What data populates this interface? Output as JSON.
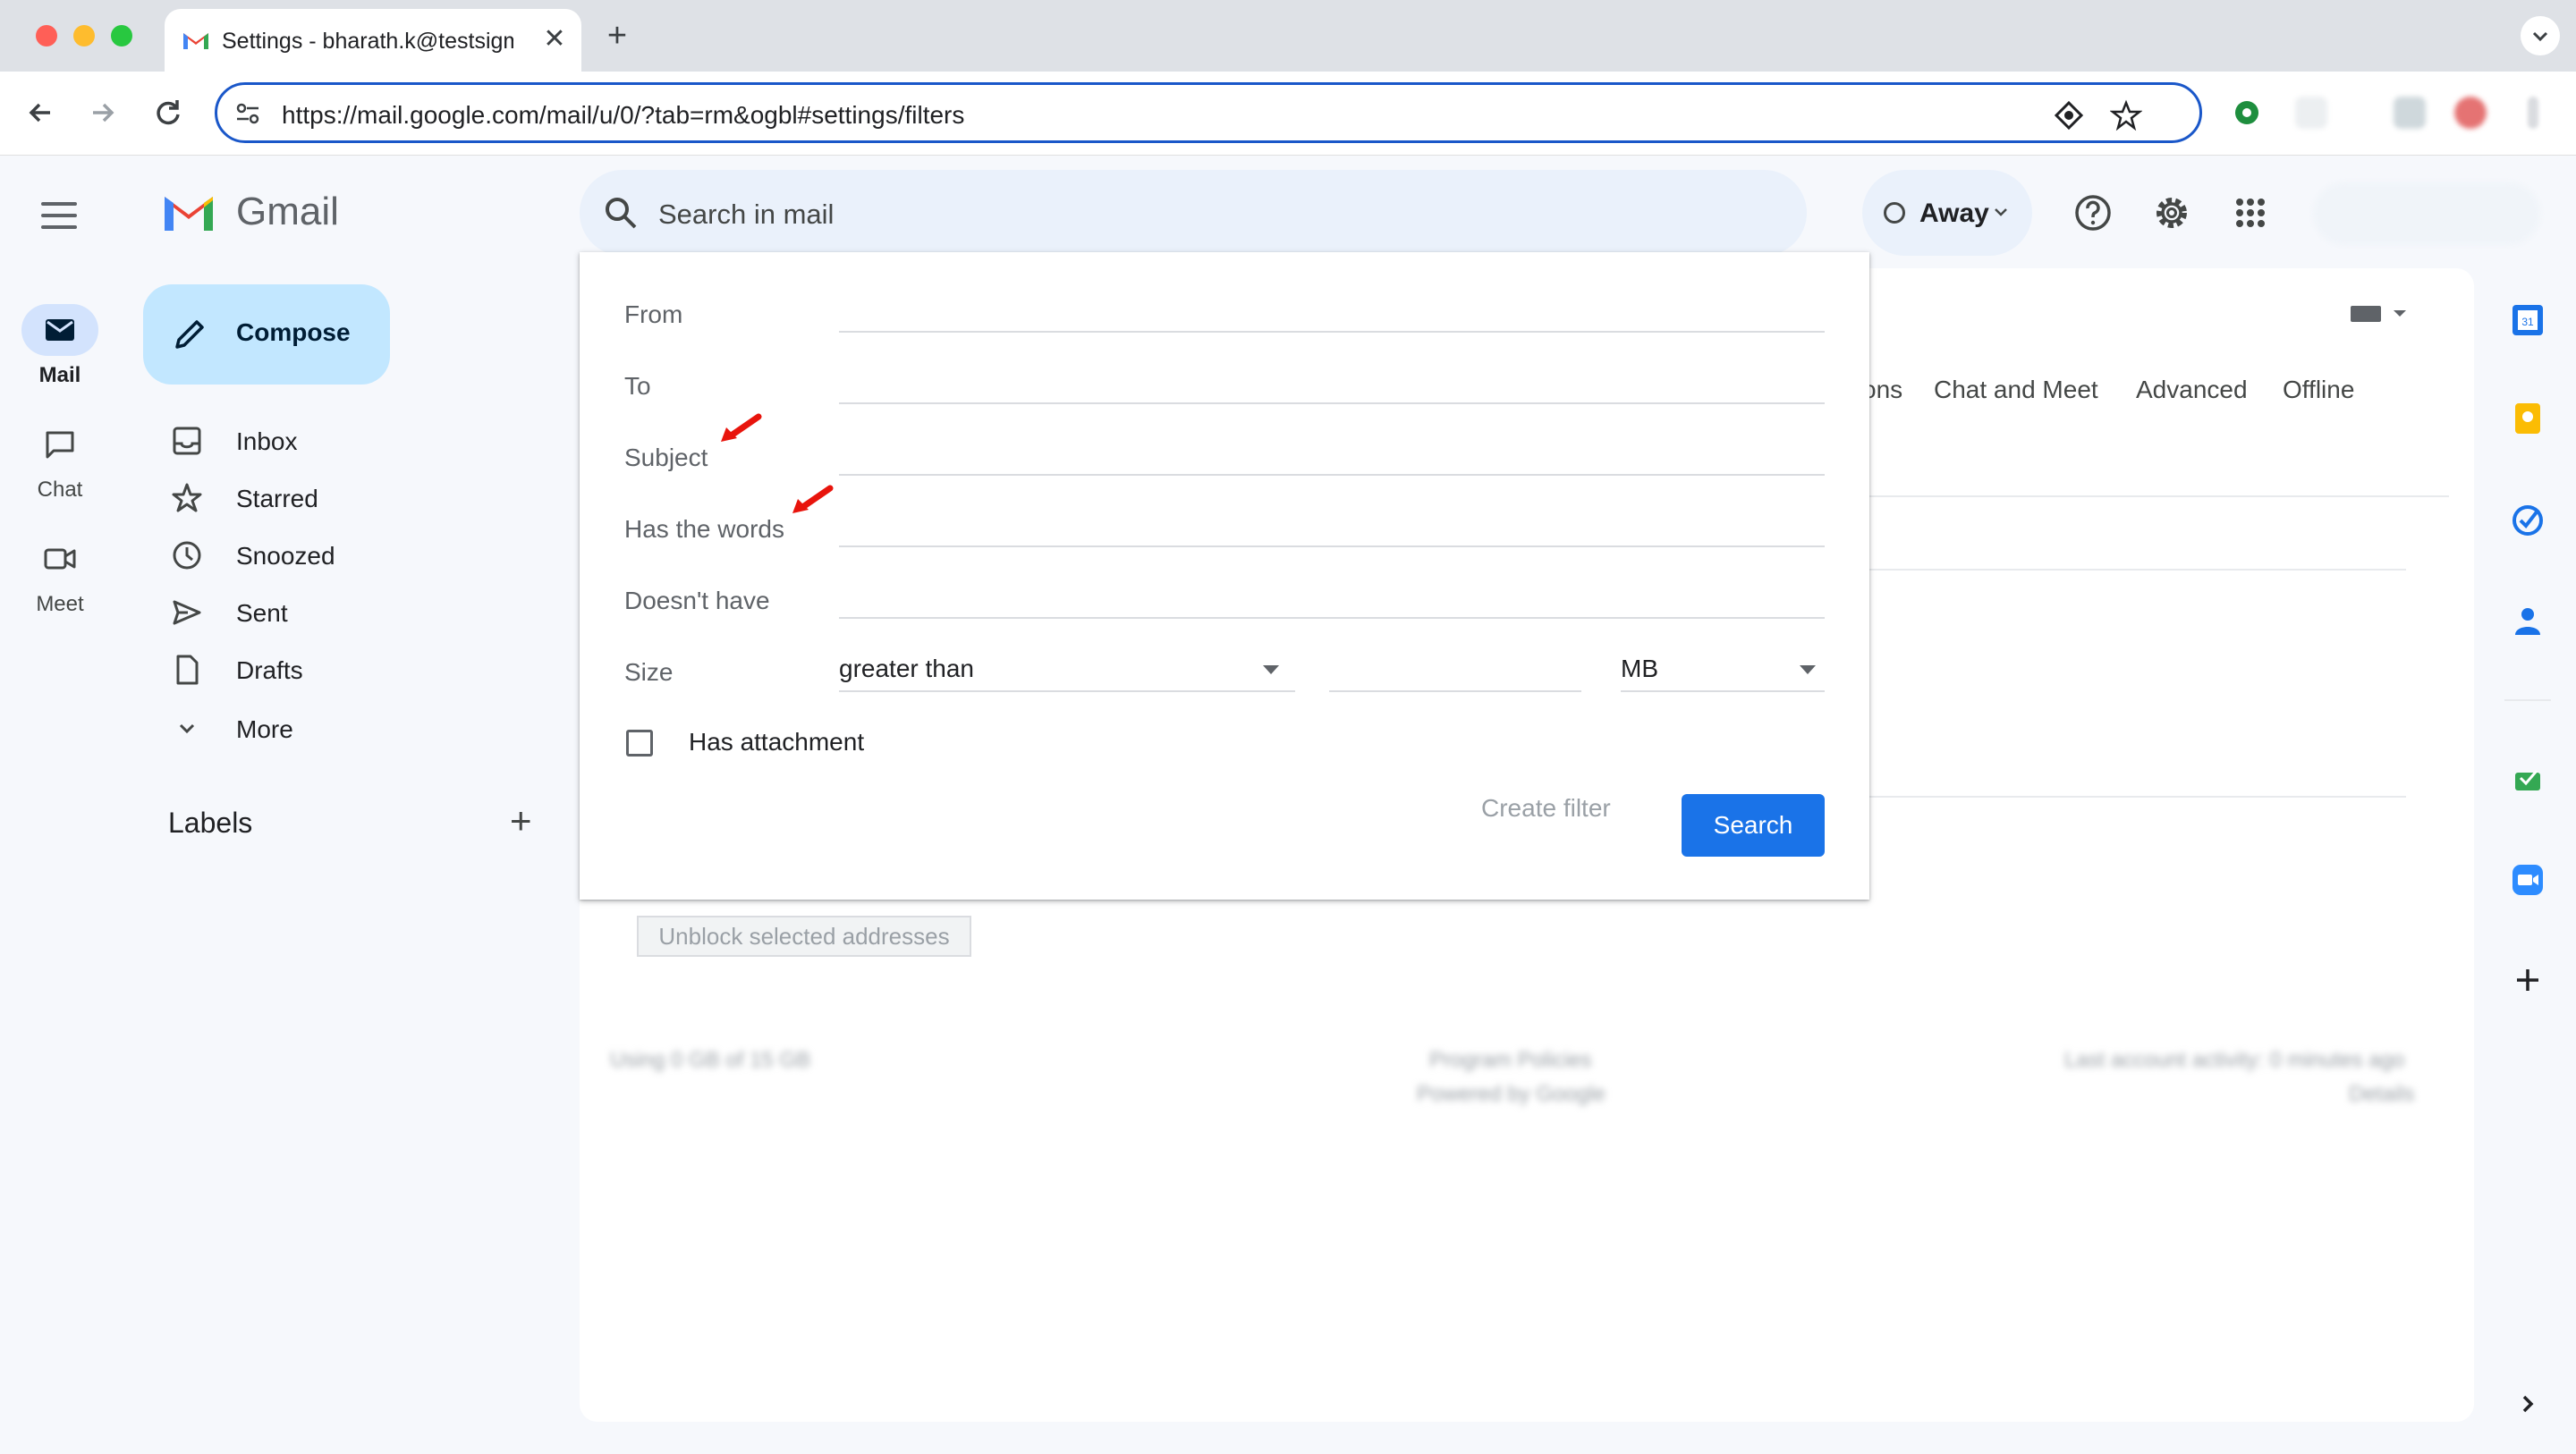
{
  "browser": {
    "tab_title": "Settings - bharath.k@testsigma.com",
    "url": "https://mail.google.com/mail/u/0/?tab=rm&ogbl#settings/filters",
    "new_tab": "+",
    "tab_close": "✕"
  },
  "gmail": {
    "app_name": "Gmail",
    "compose_label": "Compose",
    "rail": [
      {
        "label": "Mail"
      },
      {
        "label": "Chat"
      },
      {
        "label": "Meet"
      }
    ],
    "nav": [
      {
        "label": "Inbox",
        "icon": "inbox-icon"
      },
      {
        "label": "Starred",
        "icon": "star-icon"
      },
      {
        "label": "Snoozed",
        "icon": "clock-icon"
      },
      {
        "label": "Sent",
        "icon": "send-icon"
      },
      {
        "label": "Drafts",
        "icon": "draft-icon"
      },
      {
        "label": "More",
        "icon": "chevron-down-icon"
      }
    ],
    "labels_title": "Labels",
    "labels_add": "+",
    "search_placeholder": "Search in mail",
    "status": "Away",
    "settings_tabs": [
      "ons",
      "Chat and Meet",
      "Advanced",
      "Offline"
    ],
    "unblock_button": "Unblock selected addresses",
    "footer_blurred": [
      "Using 0 GB of 15 GB",
      "Program Policies",
      "Powered by Google",
      "Last account activity: 0 minutes ago",
      "Details"
    ]
  },
  "search_options": {
    "fields": [
      {
        "label": "From",
        "value": ""
      },
      {
        "label": "To",
        "value": ""
      },
      {
        "label": "Subject",
        "value": ""
      },
      {
        "label": "Has the words",
        "value": ""
      },
      {
        "label": "Doesn't have",
        "value": ""
      }
    ],
    "size_label": "Size",
    "size_operator": "greater than",
    "size_value": "",
    "size_unit": "MB",
    "has_attachment_label": "Has attachment",
    "has_attachment_checked": false,
    "create_filter_label": "Create filter",
    "search_button_label": "Search"
  },
  "colors": {
    "accent": "#1a73e8",
    "compose_bg": "#c2e7ff",
    "annotation_arrow": "#e8140c"
  }
}
